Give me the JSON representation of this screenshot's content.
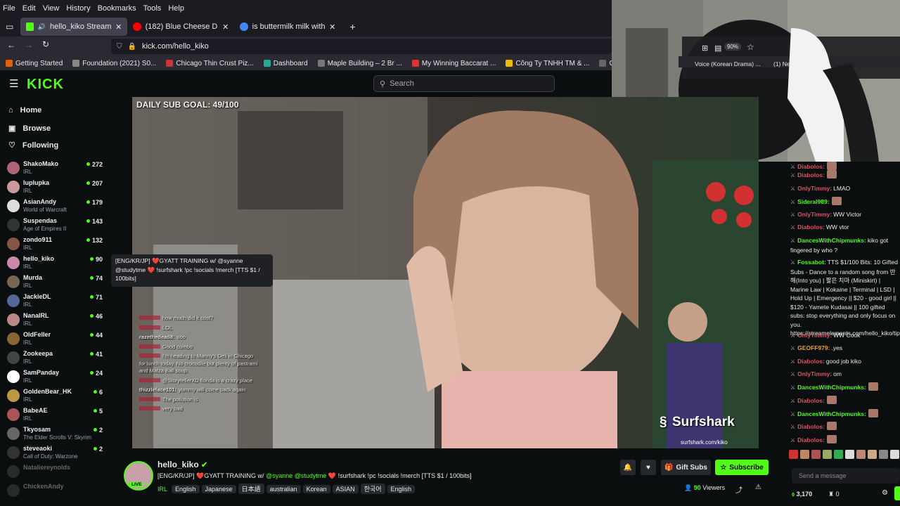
{
  "browser": {
    "menu": [
      "File",
      "Edit",
      "View",
      "History",
      "Bookmarks",
      "Tools",
      "Help"
    ],
    "tabs": [
      {
        "label": "hello_kiko Stream - Watch",
        "active": true,
        "favicon_color": "#53fc18"
      },
      {
        "label": "(182) Blue Cheese Dressing - C",
        "active": false,
        "favicon_color": "#ff0000"
      },
      {
        "label": "is buttermilk milk with vinegar",
        "active": false,
        "favicon_color": "#4285f4"
      }
    ],
    "new_tab": "+",
    "url": "kick.com/hello_kiko",
    "bookmarks": [
      {
        "label": "Getting Started",
        "color": "#e66000"
      },
      {
        "label": "Foundation (2021) S0...",
        "color": "#888"
      },
      {
        "label": "Chicago Thin Crust Piz...",
        "color": "#c33"
      },
      {
        "label": "Dashboard",
        "color": "#2a9"
      },
      {
        "label": "Maple Building – 2 Br ...",
        "color": "#777"
      },
      {
        "label": "My Winning Baccarat ...",
        "color": "#d33"
      },
      {
        "label": "Công Ty TNHH TM & ...",
        "color": "#eb0"
      },
      {
        "label": "Gold Coast – Luxury Li...",
        "color": "#666"
      },
      {
        "label": "Sign in - Drea",
        "color": "#38f"
      }
    ]
  },
  "overlay": {
    "zoom": "90%",
    "bookmark_a": "Voice (Korean Drama) ...",
    "bookmark_b": "(1) Ne"
  },
  "kick": {
    "logo": "KICK",
    "search_placeholder": "Search",
    "nav": [
      {
        "label": "Home",
        "icon": "home-icon"
      },
      {
        "label": "Browse",
        "icon": "browse-icon"
      },
      {
        "label": "Following",
        "icon": "heart-icon"
      }
    ],
    "channels": [
      {
        "name": "ShakoMako",
        "category": "IRL",
        "viewers": "272",
        "color": "#a67"
      },
      {
        "name": "luplupka",
        "category": "IRL",
        "viewers": "207",
        "color": "#c99"
      },
      {
        "name": "AsianAndy",
        "category": "World of Warcraft",
        "viewers": "179",
        "color": "#ddd"
      },
      {
        "name": "Suspendas",
        "category": "Age of Empires II",
        "viewers": "143",
        "color": "#333"
      },
      {
        "name": "zondo911",
        "category": "IRL",
        "viewers": "132",
        "color": "#854"
      },
      {
        "name": "hello_kiko",
        "category": "IRL",
        "viewers": "90",
        "color": "#c8a"
      },
      {
        "name": "Murda",
        "category": "IRL",
        "viewers": "74",
        "color": "#765"
      },
      {
        "name": "JackieDL",
        "category": "IRL",
        "viewers": "71",
        "color": "#569"
      },
      {
        "name": "NanaIRL",
        "category": "IRL",
        "viewers": "46",
        "color": "#b88"
      },
      {
        "name": "OldFeller",
        "category": "IRL",
        "viewers": "44",
        "color": "#863"
      },
      {
        "name": "Zookeepa",
        "category": "IRL",
        "viewers": "41",
        "color": "#444"
      },
      {
        "name": "SamPanday",
        "category": "IRL",
        "viewers": "24",
        "color": "#fff"
      },
      {
        "name": "GoldenBear_HK",
        "category": "IRL",
        "viewers": "6",
        "color": "#b94"
      },
      {
        "name": "BabeAE",
        "category": "IRL",
        "viewers": "5",
        "color": "#a55"
      },
      {
        "name": "Tkyosam",
        "category": "The Elder Scrolls V: Skyrim",
        "viewers": "2",
        "color": "#666"
      },
      {
        "name": "steveaoki",
        "category": "Call of Duty: Warzone",
        "viewers": "2",
        "color": "#333"
      },
      {
        "name": "Nataliereynolds",
        "category": "",
        "viewers": "",
        "color": "#555"
      },
      {
        "name": "ChickenAndy",
        "category": "",
        "viewers": "",
        "color": "#555"
      }
    ],
    "tooltip": "[ENG/KR/JP] ❤️GYATT TRAINING w/ @syanne @studytme ❤️ !surfshark !pc !socials !merch [TTS $1 / 100bits]",
    "video": {
      "goal": "DAILY SUB GOAL: 49/100",
      "sponsor": "Surfshark",
      "sponsor_url": "surfshark.com/kiko",
      "overlay_chat": [
        {
          "user": "",
          "text": "how much did it cost?"
        },
        {
          "user": "",
          "text": "LOL"
        },
        {
          "user": "razethedead8:",
          "text": "ooo"
        },
        {
          "user": "",
          "text": "Good combo"
        },
        {
          "user": "",
          "text": "I'm heading to Manny's Deli in Chicago for lunch today. No crocodile but plenty of pastrami and Matza Ball soup."
        },
        {
          "user": "",
          "text": "@StorytellerXD florida is a crazy place"
        },
        {
          "user": "thizzleface101:",
          "text": "yummy will come back again"
        },
        {
          "user": "",
          "text": "The pollution is"
        },
        {
          "user": "",
          "text": "very bad"
        }
      ]
    },
    "stream": {
      "channel": "hello_kiko",
      "live_badge": "LIVE",
      "title_prefix": "[ENG/KR/JP] ❤️GYATT TRAINING w/ ",
      "title_mention": "@syanne @studytme",
      "title_suffix": " ❤️ !surfshark !pc !socials !merch [TTS $1 / 100bits]",
      "category": "IRL",
      "tags": [
        "English",
        "Japanese",
        "日本語",
        "australian",
        "Korean",
        "ASIAN",
        "한국어",
        "English"
      ],
      "viewers": "90",
      "viewers_label": "Viewers",
      "gift_label": "Gift Subs",
      "subscribe_label": "Subscribe"
    },
    "chat": {
      "messages": [
        {
          "user": "Diabolos:",
          "text": "",
          "color": "#e05060"
        },
        {
          "user": "Diabolos:",
          "text": "",
          "color": "#e05060"
        },
        {
          "user": "OnlyTimmy:",
          "text": "LMAO",
          "color": "#e05060"
        },
        {
          "user": "Sideral989:",
          "text": "",
          "color": "#53fc18"
        },
        {
          "user": "OnlyTimmy:",
          "text": "WW Victor",
          "color": "#e05060"
        },
        {
          "user": "Diabolos:",
          "text": "WW vtor",
          "color": "#e05060"
        },
        {
          "user": "DancesWithChipmunks:",
          "text": "kiko got fingered by who ?",
          "color": "#53fc18"
        },
        {
          "user": "Fossabot:",
          "text": "TTS $1/100 Bits: 10 Gifted Subs - Dance to a random song from 반해(Into you) | 짧은 치마 (Miniskirt) | Marine Law | Kokaine | Terminal | LSD | Hold Up | Emergency || $20 - good girl || $120 - Yamete Kudasai || 100 gifted subs: stop everything and only focus on you. https://streamelements.com/hello_kiko/tip",
          "color": "#53fc18"
        },
        {
          "user": "OnlyTimmy:",
          "text": "WW Cook",
          "color": "#e05060"
        },
        {
          "user": "GEOFF979:",
          "text": ".yes",
          "color": "#e8a030"
        },
        {
          "user": "Diabolos:",
          "text": "good job kiko",
          "color": "#e05060"
        },
        {
          "user": "OnlyTimmy:",
          "text": "om",
          "color": "#e05060"
        },
        {
          "user": "DancesWithChipmunks:",
          "text": "",
          "color": "#53fc18"
        },
        {
          "user": "Diabolos:",
          "text": "",
          "color": "#e05060"
        },
        {
          "user": "DancesWithChipmunks:",
          "text": "",
          "color": "#53fc18"
        },
        {
          "user": "Diabolos:",
          "text": "",
          "color": "#e05060"
        },
        {
          "user": "Diabolos:",
          "text": "",
          "color": "#e05060"
        }
      ],
      "input_placeholder": "Send a message",
      "points": "3,170",
      "count": "0"
    }
  }
}
